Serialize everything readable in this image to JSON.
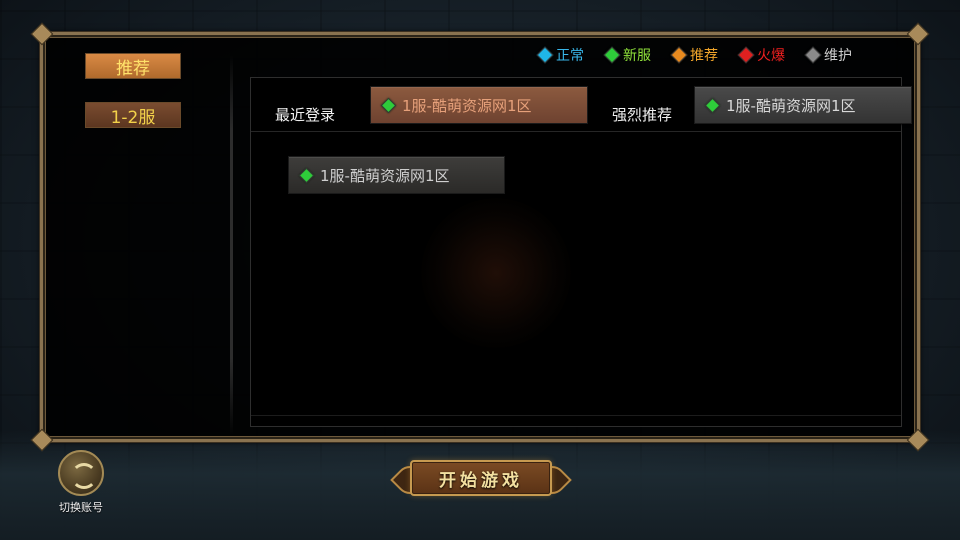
{
  "sidebar": {
    "items": [
      {
        "label": "推荐"
      },
      {
        "label": "1-2服"
      }
    ]
  },
  "legend": [
    {
      "label": "正常",
      "color": "#1fb6e8",
      "text_color": "#39b7ea",
      "icon": "cyan-gem-icon"
    },
    {
      "label": "新服",
      "color": "#2ecc3a",
      "text_color": "#8fe03a",
      "icon": "green-gem-icon"
    },
    {
      "label": "推荐",
      "color": "#e88a1f",
      "text_color": "#f0a42a",
      "icon": "orange-gem-icon"
    },
    {
      "label": "火爆",
      "color": "#e02020",
      "text_color": "#f02020",
      "icon": "red-gem-icon"
    },
    {
      "label": "维护",
      "color": "#8a8a8a",
      "text_color": "#cfcfcf",
      "icon": "gray-gem-icon"
    }
  ],
  "recent": {
    "label": "最近登录",
    "server": "1服-酷萌资源网1区"
  },
  "recommended": {
    "label": "强烈推荐",
    "server": "1服-酷萌资源网1区"
  },
  "server_list": [
    {
      "name": "1服-酷萌资源网1区"
    }
  ],
  "switch_account": {
    "label": "切换账号"
  },
  "start_button": {
    "label": "开始游戏"
  }
}
